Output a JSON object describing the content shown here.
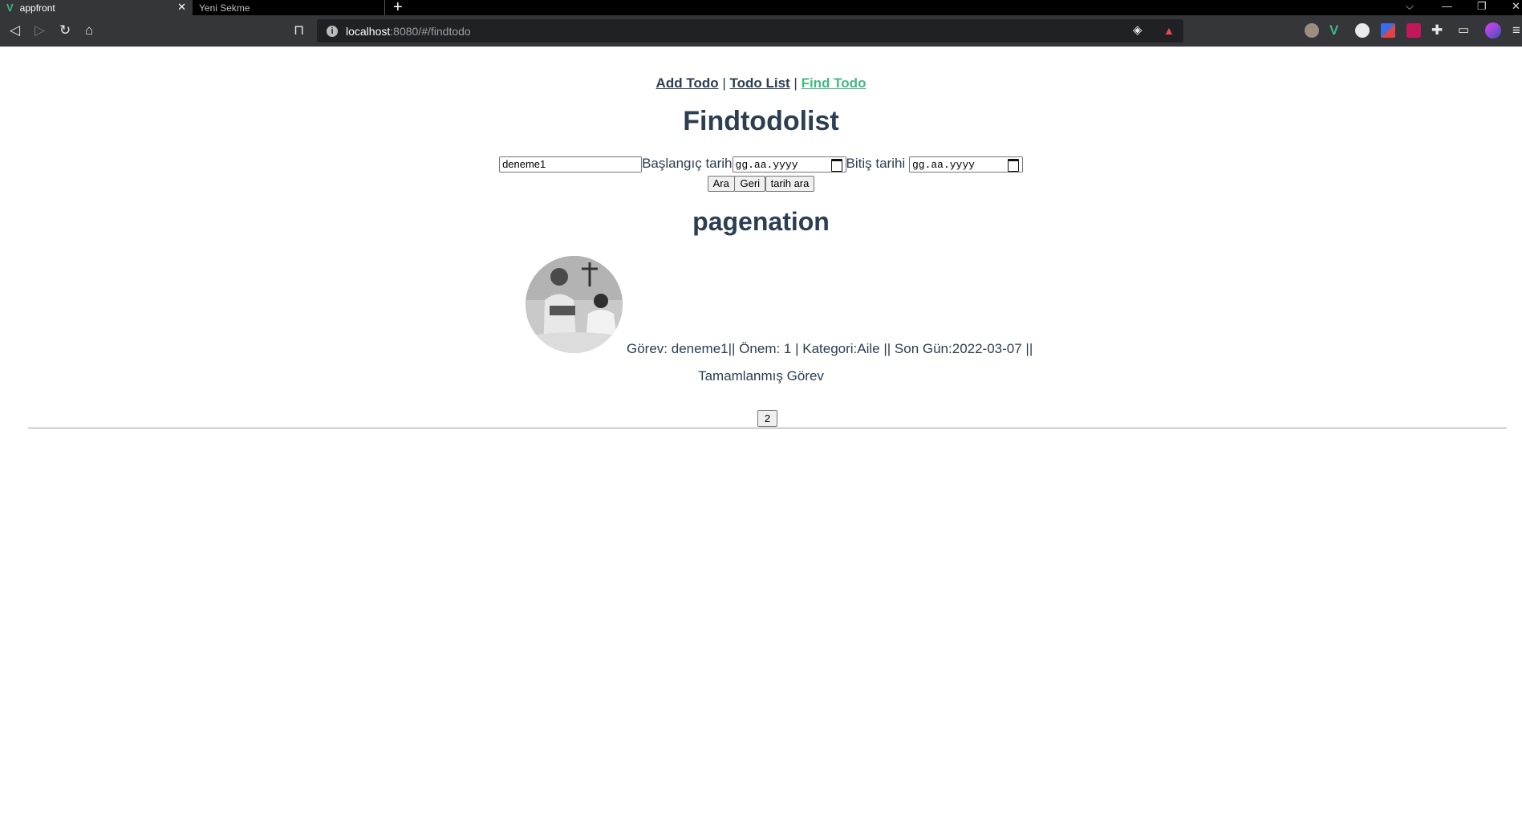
{
  "browser": {
    "tabs": [
      {
        "label": "appfront",
        "active": true
      },
      {
        "label": "Yeni Sekme",
        "active": false
      }
    ],
    "url": {
      "host": "localhost",
      "path": ":8080/#/findtodo"
    }
  },
  "nav": {
    "add_todo": "Add Todo",
    "sep1": " | ",
    "todo_list": "Todo List",
    "sep2": " | ",
    "find_todo": "Find Todo"
  },
  "page_title": "Findtodolist",
  "search": {
    "text_value": "deneme1",
    "start_label": "Başlangıç tarih",
    "start_placeholder": "gg.aa.yyyy",
    "end_label": "Bitiş tarihi",
    "end_placeholder": "gg.aa.yyyy",
    "search_button": "Ara",
    "back_button": "Geri",
    "date_search_button": "tarih ara"
  },
  "pagination_title": "pagenation",
  "todo": {
    "line": "Görev: deneme1|| Önem: 1 | Kategori:Aile || Son Gün:2022-03-07 ||",
    "status": "Tamamlanmış Görev"
  },
  "pagination": {
    "page_button": "2"
  },
  "colors": {
    "link_active": "#42b983",
    "text": "#2c3e50"
  }
}
